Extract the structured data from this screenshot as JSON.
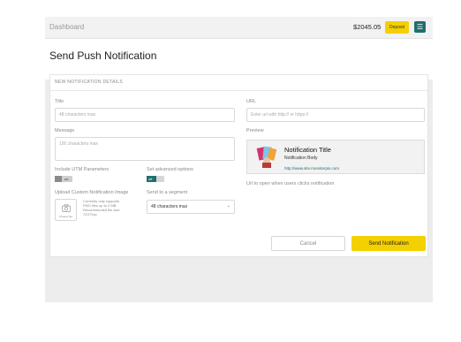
{
  "topbar": {
    "breadcrumb": "Dashboard",
    "balance": "$2045.05",
    "deposit_label": "Deposit",
    "menu_icon": "hamburger-icon"
  },
  "page": {
    "title": "Send Push Notification"
  },
  "card": {
    "heading": "NEW NOTIFICATION DETAILS",
    "title": {
      "label": "Title",
      "placeholder": "48 characters max"
    },
    "message": {
      "label": "Message",
      "placeholder": "100 characters max"
    },
    "utm": {
      "label": "Include UTM Parameters",
      "state_text": "on"
    },
    "advanced": {
      "label": "Set advanced options",
      "state_text": "off"
    },
    "upload": {
      "label": "Upload Custom Notification Image",
      "box_caption": "Choose file",
      "help_text": "Currently only supports PNG files up to 2 MB. Recommended file size 72X72px"
    },
    "segment": {
      "label": "Send to a segment",
      "value": "48 characters max"
    },
    "url": {
      "label": "URL",
      "placeholder": "Enter url with http:// or https://"
    },
    "preview": {
      "label": "Preview",
      "notification_title": "Notification Title",
      "notification_body": "Notification Body",
      "notification_url": "http://www.site.monsterpix.com"
    },
    "url_hint": "Url to open when users clicks notification",
    "cancel_label": "Cancel",
    "send_label": "Send Notification"
  },
  "colors": {
    "accent": "#1f6f6d",
    "primary_button": "#f4d000"
  }
}
